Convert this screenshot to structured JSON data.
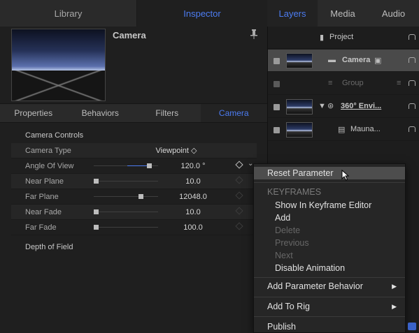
{
  "top_tabs": {
    "library": "Library",
    "inspector": "Inspector"
  },
  "right_tabs": [
    "Layers",
    "Media",
    "Audio"
  ],
  "inspector": {
    "title": "Camera",
    "subtabs": [
      "Properties",
      "Behaviors",
      "Filters",
      "Camera"
    ],
    "active_subtab": "Camera",
    "section_camera_controls": "Camera Controls",
    "params": [
      {
        "label": "Camera Type",
        "value": "Viewpoint ◇"
      },
      {
        "label": "Angle Of View",
        "value": "120.0 °"
      },
      {
        "label": "Near Plane",
        "value": "10.0"
      },
      {
        "label": "Far Plane",
        "value": "12048.0"
      },
      {
        "label": "Near Fade",
        "value": "10.0"
      },
      {
        "label": "Far Fade",
        "value": "100.0"
      }
    ],
    "section_depth_of_field": "Depth of Field"
  },
  "layers": [
    {
      "name": "Project"
    },
    {
      "name": "Camera"
    },
    {
      "name": "Group"
    },
    {
      "name": "360° Envi..."
    },
    {
      "name": "Mauna..."
    }
  ],
  "context_menu": {
    "reset": "Reset Parameter",
    "keyframes_header": "KEYFRAMES",
    "show_in_editor": "Show In Keyframe Editor",
    "add": "Add",
    "delete": "Delete",
    "previous": "Previous",
    "next": "Next",
    "disable_animation": "Disable Animation",
    "add_param_behavior": "Add Parameter Behavior",
    "add_to_rig": "Add To Rig",
    "publish": "Publish"
  },
  "colors": {
    "accent": "#4c7cf2",
    "background": "#1e1e1e"
  }
}
